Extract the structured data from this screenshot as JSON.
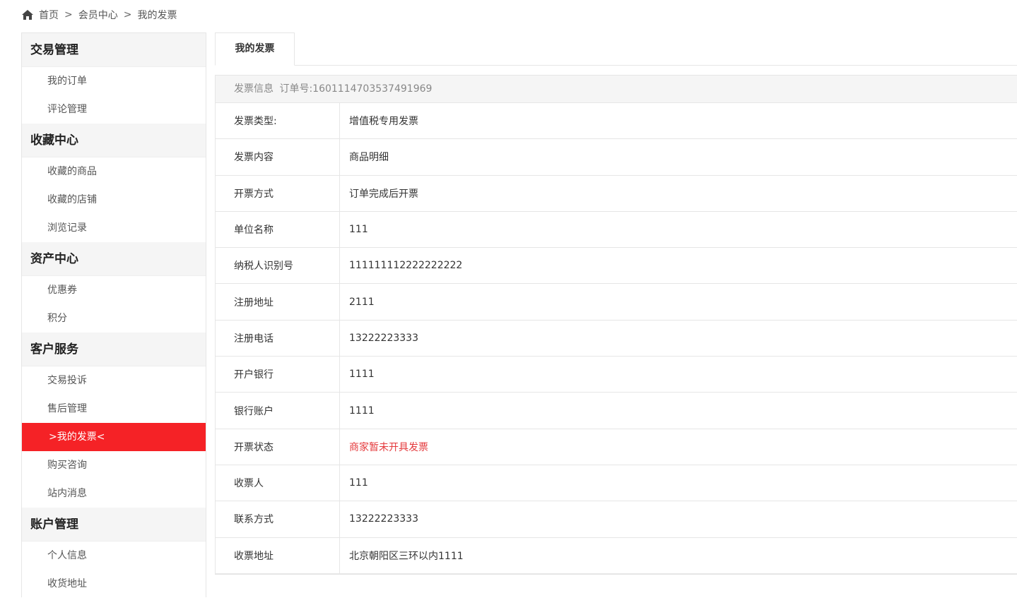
{
  "breadcrumb": {
    "home_icon": "home-icon",
    "items": [
      "首页",
      "会员中心",
      "我的发票"
    ],
    "separator": ">"
  },
  "sidebar": {
    "groups": [
      {
        "title": "交易管理",
        "items": [
          "我的订单",
          "评论管理"
        ]
      },
      {
        "title": "收藏中心",
        "items": [
          "收藏的商品",
          "收藏的店铺",
          "浏览记录"
        ]
      },
      {
        "title": "资产中心",
        "items": [
          "优惠券",
          "积分"
        ]
      },
      {
        "title": "客户服务",
        "items": [
          "交易投诉",
          "售后管理",
          ">我的发票<",
          "购买咨询",
          "站内消息"
        ]
      },
      {
        "title": "账户管理",
        "items": [
          "个人信息",
          "收货地址"
        ]
      }
    ],
    "active_item": ">我的发票<",
    "active_color": "#f52226"
  },
  "tabs": {
    "active": "我的发票"
  },
  "invoice": {
    "header_label": "发票信息",
    "order_label": "订单号:",
    "order_number": "1601114703537491969",
    "rows": [
      {
        "label": "发票类型:",
        "value": "增值税专用发票"
      },
      {
        "label": "发票内容",
        "value": "商品明细"
      },
      {
        "label": "开票方式",
        "value": "订单完成后开票"
      },
      {
        "label": "单位名称",
        "value": "111"
      },
      {
        "label": "纳税人识别号",
        "value": "111111112222222222"
      },
      {
        "label": "注册地址",
        "value": "2111"
      },
      {
        "label": "注册电话",
        "value": "13222223333"
      },
      {
        "label": "开户银行",
        "value": "1111"
      },
      {
        "label": "银行账户",
        "value": "1111"
      },
      {
        "label": "开票状态",
        "value": "商家暂未开具发票"
      },
      {
        "label": "收票人",
        "value": "111"
      },
      {
        "label": "联系方式",
        "value": "13222223333"
      },
      {
        "label": "收票地址",
        "value": "北京朝阳区三环以内1111"
      }
    ],
    "status_color": "#e4393c"
  }
}
